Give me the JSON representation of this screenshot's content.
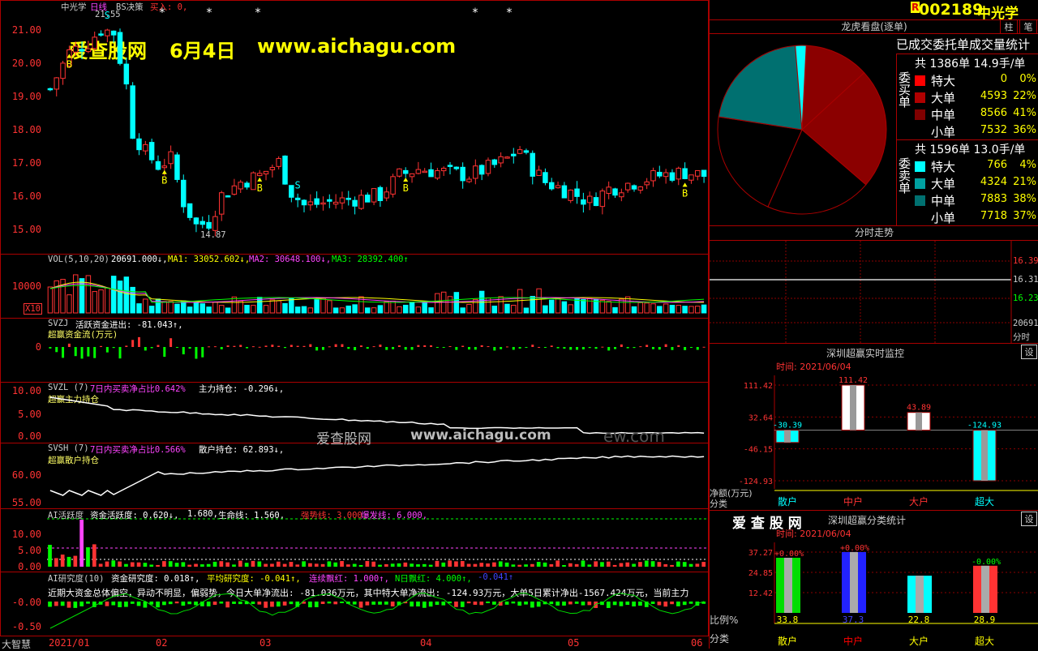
{
  "stock": {
    "code": "002189",
    "name": "中光学",
    "badge": "R",
    "btn_col": "柱",
    "btn_pen": "笔"
  },
  "watermark": {
    "site": "爱查股网",
    "date": "6月4日",
    "url": "www.aichagu.com",
    "center_site": "爱查股网",
    "center_url": "www.aichagu.com",
    "center_tail": "ew.com"
  },
  "main_chart": {
    "header_name": "中光学",
    "header_period": "日线",
    "header_indicator": "BS决策",
    "header_signal": "买入: 0,",
    "high_label": "21.55",
    "low_label": "14.87",
    "y_ticks": [
      "21.00",
      "20.00",
      "19.00",
      "18.00",
      "17.00",
      "16.00",
      "15.00"
    ]
  },
  "vol_panel": {
    "label": "VOL(5,10,20)",
    "value": "20691.000↓,",
    "ma1": "MA1: 33052.602↓,",
    "ma2": "MA2: 30648.100↓,",
    "ma3": "MA3: 28392.400↑",
    "y_tick": "10000",
    "unit": "X10"
  },
  "svzj_panel": {
    "label": "SVZJ",
    "title": "活跃资金进出: -81.043↑,",
    "subtitle": "超赢资金流(万元)",
    "y_tick": "0"
  },
  "svzl_panel": {
    "label": "SVZL (7)",
    "ratio": "7日内买卖净占比0.642%",
    "hold": "主力持仓: -0.296↓,",
    "subtitle": "超赢主力持仓",
    "y_ticks": [
      "10.00",
      "5.00",
      "0.00"
    ]
  },
  "svsh_panel": {
    "label": "SVSH (7)",
    "ratio": "7日内买卖净占比0.566%",
    "hold": "散户持仓: 62.893↓,",
    "subtitle": "超赢散户持仓",
    "y_ticks": [
      "60.00",
      "55.00"
    ]
  },
  "ai_active": {
    "label": "AI活跃度",
    "a": "资金活跃度: 0.620↓,",
    "b": "1.680,",
    "c": "生命线: 1.560,",
    "d": "强势线: 3.000,",
    "e": "爆发线: 6.000,",
    "y_ticks": [
      "10.00",
      "5.00",
      "0.00"
    ]
  },
  "ai_research": {
    "label": "AI研究度(10)",
    "a": "资金研究度: 0.018↑,",
    "b": "平均研究度: -0.041↑,",
    "c": "连续飘红: 1.000↑,",
    "d": "N日飘红: 4.000↑,",
    "e": "-0.041↑",
    "comment": "近期大资金总体偏空，异动不明显，偏弱势，今日大单净流出: -81.036万元，其中特大单净流出: -124.93万元，大单5日累计净出-1567.424万元，当前主力",
    "y_ticks": [
      "-0.00",
      "-0.50"
    ]
  },
  "x_axis": {
    "labels": [
      "2021/01",
      "02",
      "03",
      "04",
      "05",
      "06"
    ],
    "corner": "大智慧"
  },
  "dragon": {
    "title": "龙虎看盘(逐单)",
    "stat_title": "已成交委托单成交量统计",
    "buy_side": "委买单",
    "sell_side": "委卖单",
    "buy_total": "共 1386单 14.9手/单",
    "buy_rows": [
      {
        "name": "特大",
        "value": "0",
        "pct": "0%",
        "color": "#ff0000"
      },
      {
        "name": "大单",
        "value": "4593",
        "pct": "22%",
        "color": "#b00000"
      },
      {
        "name": "中单",
        "value": "8566",
        "pct": "41%",
        "color": "#800000"
      },
      {
        "name": "小单",
        "value": "7532",
        "pct": "36%",
        "color": "#000000"
      }
    ],
    "sell_total": "共 1596单 13.0手/单",
    "sell_rows": [
      {
        "name": "特大",
        "value": "766",
        "pct": "4%",
        "color": "#00ffff"
      },
      {
        "name": "大单",
        "value": "4324",
        "pct": "21%",
        "color": "#00a0a0"
      },
      {
        "name": "中单",
        "value": "7883",
        "pct": "38%",
        "color": "#007070"
      },
      {
        "name": "小单",
        "value": "7718",
        "pct": "37%",
        "color": "#000000"
      }
    ]
  },
  "intraday": {
    "title": "分时走势",
    "ticks": [
      "16.39",
      "16.31",
      "16.23"
    ],
    "vol": "20691",
    "vol_unit": "分时"
  },
  "realtime": {
    "title": "深圳超赢实时监控",
    "settings": "设",
    "time": "时间: 2021/06/04",
    "y_ticks": [
      "111.42",
      "32.64",
      "-46.15",
      "-124.93"
    ],
    "unit_label": "净额(万元)",
    "cat_label": "分类",
    "bars": [
      {
        "name": "散户",
        "value": -30.39,
        "label": "-30.39",
        "color": "#00ffff"
      },
      {
        "name": "中户",
        "value": 111.42,
        "label": "111.42",
        "color": "#ffffff"
      },
      {
        "name": "大户",
        "value": 43.89,
        "label": "43.89",
        "color": "#ffffff"
      },
      {
        "name": "超大",
        "value": -124.93,
        "label": "-124.93",
        "color": "#00ffff"
      }
    ]
  },
  "classify": {
    "brand": "爱 查 股 网",
    "title": "深圳超赢分类统计",
    "settings": "设",
    "time": "时间: 2021/06/04",
    "y_ticks": [
      "37.27",
      "24.85",
      "12.42"
    ],
    "ratio_label": "比例%",
    "cat_label": "分类",
    "bars": [
      {
        "name": "散户",
        "value": 33.8,
        "label": "33.8",
        "top": "+0.00%",
        "color": "#00dd00",
        "name_color": "#ffff00"
      },
      {
        "name": "中户",
        "value": 37.3,
        "label": "37.3",
        "top": "+0.00%",
        "color": "#2222ff",
        "name_color": "#ff0000"
      },
      {
        "name": "大户",
        "value": 22.8,
        "label": "22.8",
        "top": "",
        "color": "#00ffff",
        "name_color": "#ffff00"
      },
      {
        "name": "超大",
        "value": 28.9,
        "label": "28.9",
        "top": "-0.00%",
        "color": "#ff3333",
        "name_color": "#ffff00"
      }
    ]
  }
}
